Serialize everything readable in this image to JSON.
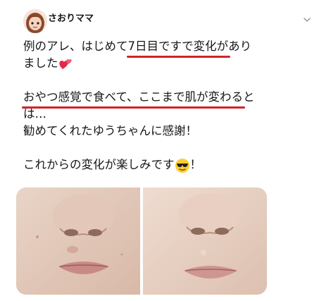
{
  "user": {
    "display_name": "さおりママ"
  },
  "tweet": {
    "line1": {
      "pre": "例のアレ、はじめて",
      "u": "7日目ですで変化が",
      "post": "あり"
    },
    "line2": "ました",
    "line3": {
      "u": "おやつ感覚で食べて、ここまで肌が変わる",
      "post": "と"
    },
    "line4": "は…",
    "line5": "勧めてくれたゆうちゃんに感謝！",
    "line6": {
      "pre": "これからの変化が楽しみです",
      "post": "！"
    }
  },
  "icons": {
    "menu": "chevron-down-icon",
    "heart": "two-hearts-emoji",
    "sunglasses": "smiling-face-with-sunglasses-emoji"
  },
  "colors": {
    "underline": "#d22328",
    "text": "#14171a",
    "chevron": "#8899a6"
  }
}
